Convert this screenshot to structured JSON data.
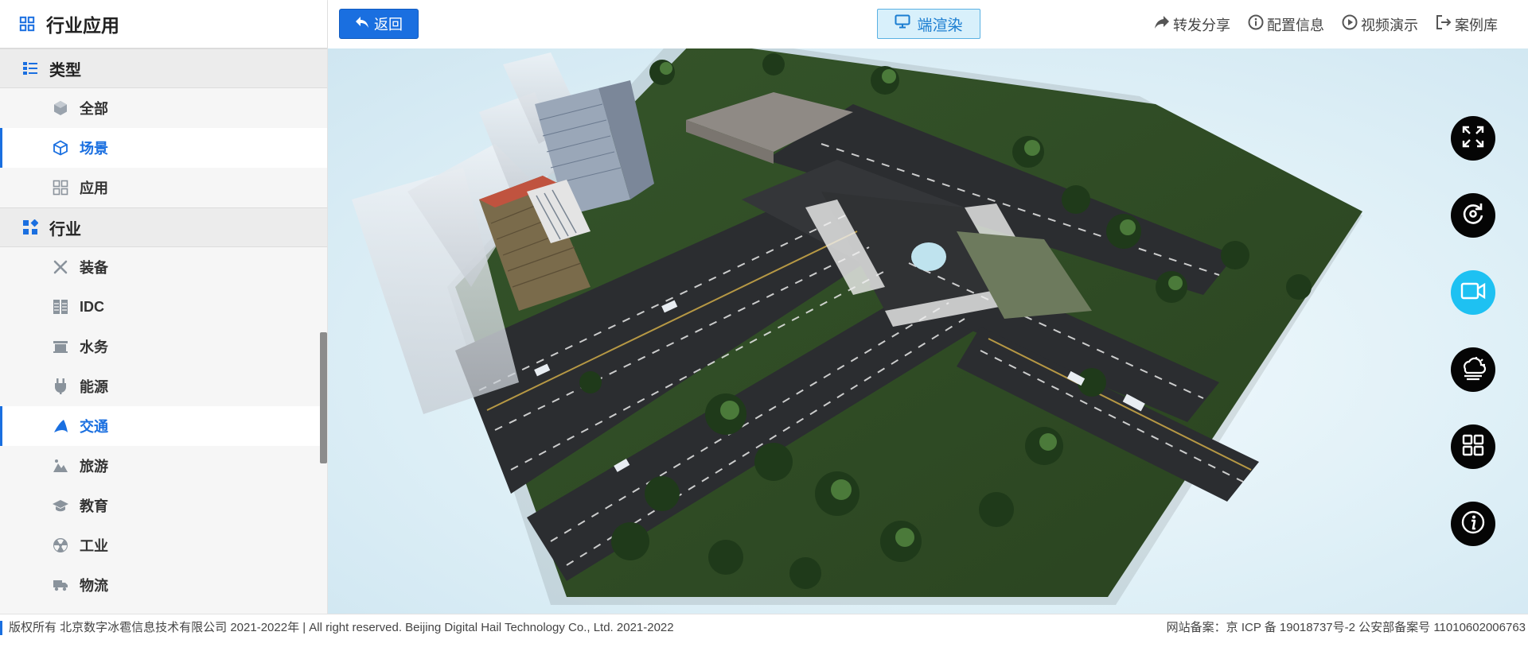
{
  "sidebar": {
    "title": "行业应用",
    "groups": [
      {
        "label": "类型",
        "items": [
          {
            "label": "全部",
            "icon": "cube-solid-icon"
          },
          {
            "label": "场景",
            "icon": "cube-outline-icon",
            "active": true
          },
          {
            "label": "应用",
            "icon": "app-grid-icon"
          }
        ]
      },
      {
        "label": "行业",
        "items": [
          {
            "label": "装备",
            "icon": "tools-icon"
          },
          {
            "label": "IDC",
            "icon": "server-icon"
          },
          {
            "label": "水务",
            "icon": "water-icon"
          },
          {
            "label": "能源",
            "icon": "plug-icon"
          },
          {
            "label": "交通",
            "icon": "road-icon",
            "active": true
          },
          {
            "label": "旅游",
            "icon": "mountain-icon"
          },
          {
            "label": "教育",
            "icon": "graduation-cap-icon"
          },
          {
            "label": "工业",
            "icon": "radiation-icon"
          },
          {
            "label": "物流",
            "icon": "truck-icon"
          }
        ]
      }
    ]
  },
  "toolbar": {
    "back_label": "返回",
    "render_label": "端渲染",
    "nav": [
      {
        "label": "转发分享",
        "icon": "share-icon"
      },
      {
        "label": "配置信息",
        "icon": "info-circle-icon"
      },
      {
        "label": "视频演示",
        "icon": "play-circle-icon"
      },
      {
        "label": "案例库",
        "icon": "logout-icon"
      }
    ]
  },
  "tools": [
    "fullscreen-icon",
    "reset-view-icon",
    "camera-icon",
    "weather-icon",
    "layout-grid-icon",
    "info-icon"
  ],
  "colors": {
    "accent": "#1a6fe0",
    "tool_active": "#1ec1f2",
    "tool_bg": "#050505"
  },
  "footer": {
    "copyright": "版权所有 北京数字冰雹信息技术有限公司 2021-2022年 | All right reserved. Beijing Digital Hail Technology Co., Ltd. 2021-2022",
    "icp": "网站备案：京 ICP 备 19018737号-2 公安部备案号 11010602006763"
  }
}
